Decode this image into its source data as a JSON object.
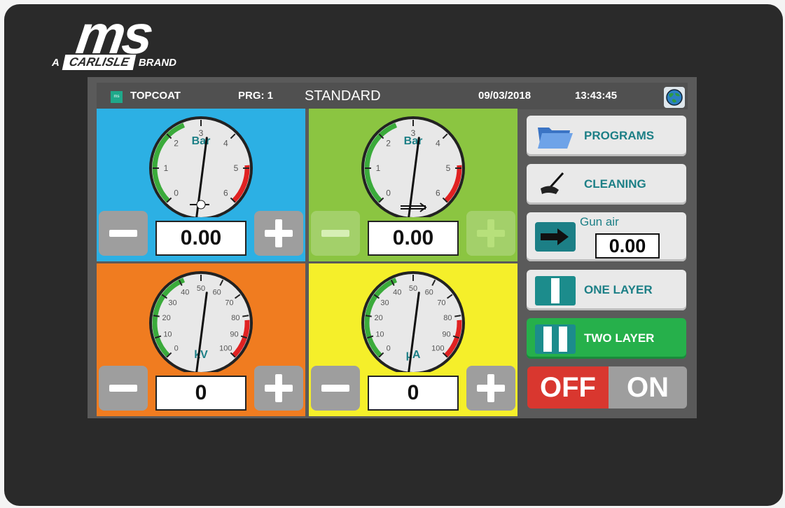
{
  "brand": {
    "logo": "ms",
    "prefix": "A",
    "carlisle": "CARLISLE",
    "suffix": "BRAND"
  },
  "header": {
    "mode": "TOPCOAT",
    "program_label": "PRG: 1",
    "program_name": "STANDARD",
    "date": "09/03/2018",
    "time": "13:43:45"
  },
  "quadrants": [
    {
      "unit": "Bar",
      "ticks": [
        "0",
        "1",
        "2",
        "3",
        "4",
        "5",
        "6"
      ],
      "value": "0.00",
      "color": "#2cb0e4",
      "icon": "paint-drop-icon",
      "reading_fraction": 0.54
    },
    {
      "unit": "Bar",
      "ticks": [
        "0",
        "1",
        "2",
        "3",
        "4",
        "5",
        "6"
      ],
      "value": "0.00",
      "color": "#8bc541",
      "icon": "spray-fan-icon",
      "reading_fraction": 0.54
    },
    {
      "unit": "kV",
      "ticks": [
        "0",
        "10",
        "20",
        "30",
        "40",
        "50",
        "60",
        "70",
        "80",
        "90",
        "100"
      ],
      "value": "0",
      "color": "#f07c20",
      "icon": "",
      "reading_fraction": 0.54
    },
    {
      "unit": "µA",
      "ticks": [
        "0",
        "10",
        "20",
        "30",
        "40",
        "50",
        "60",
        "70",
        "80",
        "90",
        "100"
      ],
      "value": "0",
      "color": "#f5ef2a",
      "icon": "",
      "reading_fraction": 0.54
    }
  ],
  "sidebar": {
    "programs": "PROGRAMS",
    "cleaning": "CLEANING",
    "gun_air_label": "Gun air",
    "gun_air_value": "0.00",
    "one_layer": "ONE LAYER",
    "two_layer": "TWO LAYER",
    "off": "OFF",
    "on": "ON"
  },
  "colors": {
    "accent": "#1c7f86",
    "active": "#26b04b",
    "off": "#d9372f"
  }
}
